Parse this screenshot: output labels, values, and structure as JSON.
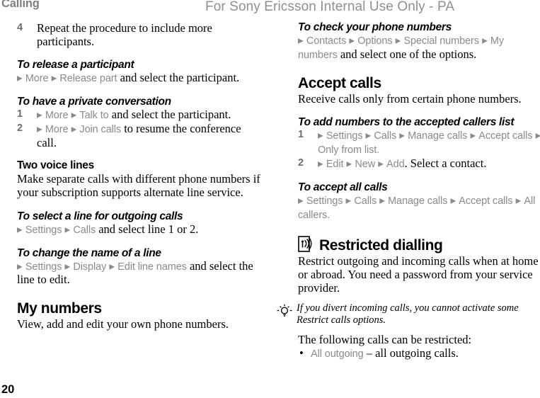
{
  "header": {
    "running_head": "Calling",
    "watermark": "For Sony Ericsson Internal Use Only - PA"
  },
  "footer": {
    "page_number": "20"
  },
  "arrow_glyph": "▶",
  "bullet_glyph": "•",
  "left_column": {
    "step4": {
      "number": "4",
      "text": "Repeat the procedure to include more participants."
    },
    "release_participant": {
      "heading": "To release a participant",
      "ui_1": "More",
      "ui_2": "Release part",
      "tail": " and select the participant."
    },
    "private_conversation": {
      "heading": "To have a private conversation",
      "step1": {
        "number": "1",
        "ui_1": "More",
        "ui_2": "Talk to",
        "tail": " and select the participant."
      },
      "step2": {
        "number": "2",
        "ui_1": "More",
        "ui_2": "Join calls",
        "tail": " to resume the conference call."
      }
    },
    "two_voice_lines": {
      "heading": "Two voice lines",
      "body": "Make separate calls with different phone numbers if your subscription supports alternate line service."
    },
    "select_line": {
      "heading": "To select a line for outgoing calls",
      "ui_1": "Settings",
      "ui_2": "Calls",
      "tail": " and select line 1 or 2."
    },
    "change_line_name": {
      "heading": "To change the name of a line",
      "ui_1": "Settings",
      "ui_2": "Display",
      "ui_3": "Edit line names",
      "tail": " and select the line to edit."
    },
    "my_numbers": {
      "heading": "My numbers",
      "body": "View, add and edit your own phone numbers."
    }
  },
  "right_column": {
    "check_phone_numbers": {
      "heading": "To check your phone numbers",
      "ui_1": "Contacts",
      "ui_2": "Options",
      "ui_3": "Special numbers",
      "ui_4": "My numbers",
      "tail": " and select one of the options."
    },
    "accept_calls": {
      "heading": "Accept calls",
      "body": "Receive calls only from certain phone numbers."
    },
    "add_numbers": {
      "heading": "To add numbers to the accepted callers list",
      "step1": {
        "number": "1",
        "ui_1": "Settings",
        "ui_2": "Calls",
        "ui_3": "Manage calls",
        "ui_4": "Accept calls",
        "ui_5": "Only from list."
      },
      "step2": {
        "number": "2",
        "ui_1": "Edit",
        "ui_2": "New",
        "ui_3": "Add",
        "tail": ". Select a contact."
      }
    },
    "accept_all_calls": {
      "heading": "To accept all calls",
      "ui_1": "Settings",
      "ui_2": "Calls",
      "ui_3": "Manage calls",
      "ui_4": "Accept calls",
      "ui_5": "All callers."
    },
    "restricted_dialling": {
      "icon": "restricted-dialling-icon",
      "heading": "Restricted dialling",
      "body": "Restrict outgoing and incoming calls when at home or abroad. You need a password from your service provider.",
      "note_icon": "tip-lightbulb-icon",
      "note": "If you divert incoming calls, you cannot activate some Restrict calls options.",
      "intro": "The following calls can be restricted:",
      "bullet_1": {
        "ui": "All outgoing",
        "tail": " – all outgoing calls."
      }
    }
  },
  "colors": {
    "ui_term_gray": "#8a8a8a",
    "running_head_gray": "#7f7f7f",
    "watermark_gray": "#8f8f8f",
    "body_black": "#000000"
  }
}
